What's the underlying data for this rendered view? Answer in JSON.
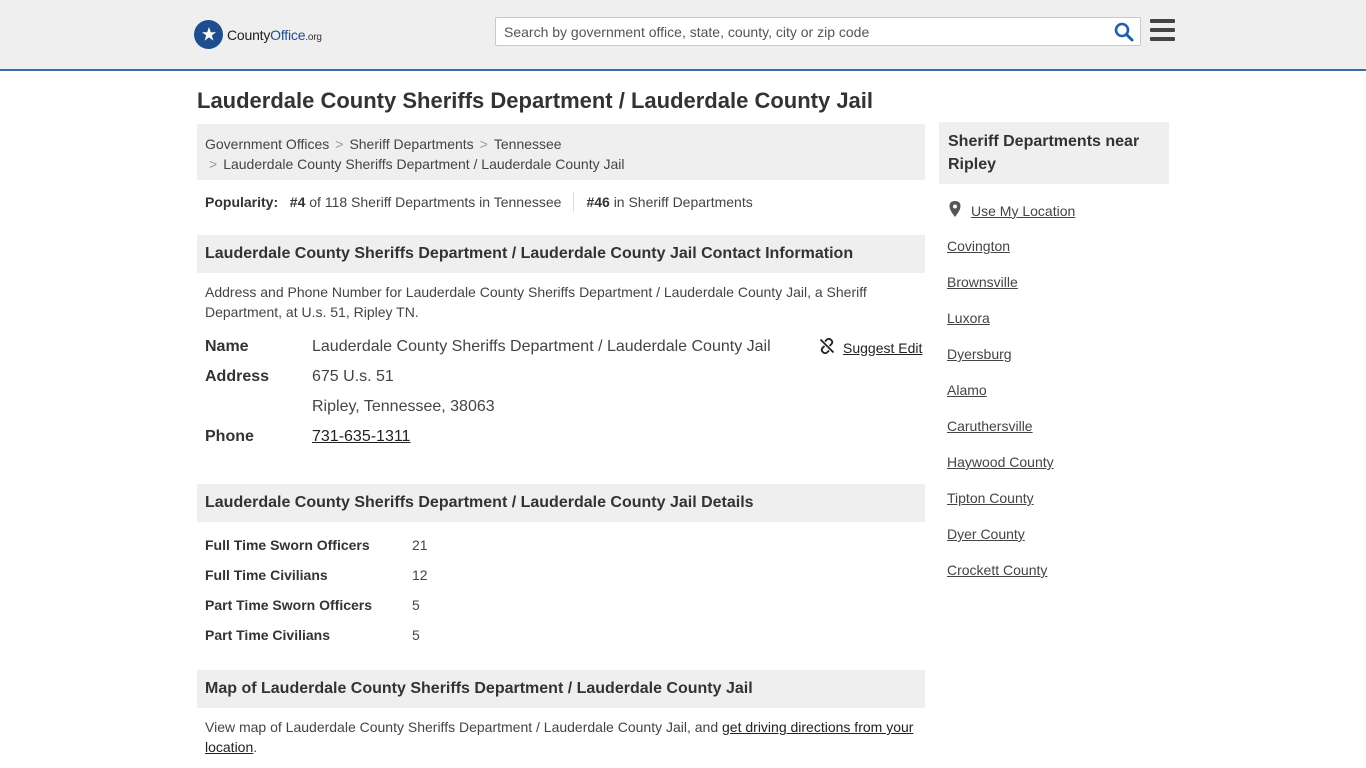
{
  "header": {
    "logo_text": "County",
    "logo_bold": "Office",
    "logo_suffix": ".org",
    "search_placeholder": "Search by government office, state, county, city or zip code"
  },
  "page": {
    "title": "Lauderdale County Sheriffs Department / Lauderdale County Jail"
  },
  "breadcrumb": {
    "items": [
      "Government Offices",
      "Sheriff Departments",
      "Tennessee",
      "Lauderdale County Sheriffs Department / Lauderdale County Jail"
    ],
    "separator": ">"
  },
  "popularity": {
    "label": "Popularity:",
    "state_rank": "#4",
    "state_text": "of 118 Sheriff Departments in Tennessee",
    "national_rank": "#46",
    "national_text": "in Sheriff Departments"
  },
  "contact": {
    "heading": "Lauderdale County Sheriffs Department / Lauderdale County Jail Contact Information",
    "description": "Address and Phone Number for Lauderdale County Sheriffs Department / Lauderdale County Jail, a Sheriff Department, at U.s. 51, Ripley TN.",
    "name_label": "Name",
    "name_value": "Lauderdale County Sheriffs Department / Lauderdale County Jail",
    "address_label": "Address",
    "address_line1": "675 U.s. 51",
    "address_line2": "Ripley, Tennessee, 38063",
    "phone_label": "Phone",
    "phone_value": "731-635-1311",
    "suggest_edit": "Suggest Edit"
  },
  "details": {
    "heading": "Lauderdale County Sheriffs Department / Lauderdale County Jail Details",
    "rows": [
      {
        "label": "Full Time Sworn Officers",
        "value": "21"
      },
      {
        "label": "Full Time Civilians",
        "value": "12"
      },
      {
        "label": "Part Time Sworn Officers",
        "value": "5"
      },
      {
        "label": "Part Time Civilians",
        "value": "5"
      }
    ]
  },
  "map": {
    "heading": "Map of Lauderdale County Sheriffs Department / Lauderdale County Jail",
    "text": "View map of Lauderdale County Sheriffs Department / Lauderdale County Jail, and ",
    "link": "get driving directions from your location",
    "end": "."
  },
  "sidebar": {
    "heading": "Sheriff Departments near Ripley",
    "use_location": "Use My Location",
    "links": [
      "Covington",
      "Brownsville",
      "Luxora",
      "Dyersburg",
      "Alamo",
      "Caruthersville",
      "Haywood County",
      "Tipton County",
      "Dyer County",
      "Crockett County"
    ]
  },
  "icons": {
    "logo": "star-seal-icon",
    "search": "search-icon",
    "menu": "hamburger-menu-icon",
    "edit": "broken-link-icon",
    "location": "map-pin-icon"
  },
  "colors": {
    "brand": "#1f4e8c",
    "search_icon": "#1f5fa8",
    "panel_bg": "#efeff0",
    "header_border": "#3a6aa6"
  }
}
